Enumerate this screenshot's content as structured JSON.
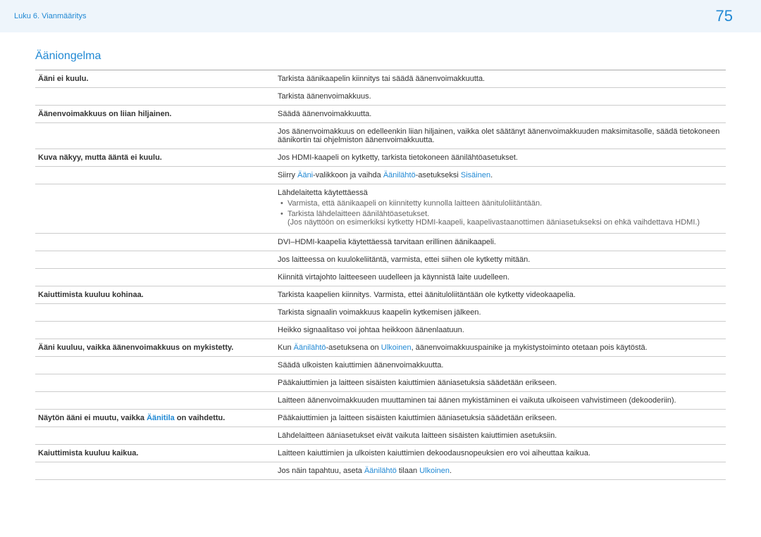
{
  "header": {
    "breadcrumb": "Luku 6. Vianmääritys",
    "page_number": "75"
  },
  "section_title": "Ääniongelma",
  "ui_terms": {
    "aani": "Ääni",
    "aanilahto": "Äänilähtö",
    "sisainen": "Sisäinen",
    "ulkoinen": "Ulkoinen",
    "aanitila": "Äänitila"
  },
  "rows": [
    {
      "left": "Ääni ei kuulu.",
      "right": "Tarkista äänikaapelin kiinnitys tai säädä äänenvoimakkuutta."
    },
    {
      "left": "",
      "right": "Tarkista äänenvoimakkuus."
    },
    {
      "left": "Äänenvoimakkuus on liian hiljainen.",
      "right": "Säädä äänenvoimakkuutta."
    },
    {
      "left": "",
      "right": "Jos äänenvoimakkuus on edelleenkin liian hiljainen, vaikka olet säätänyt äänenvoimakkuuden maksimitasolle, säädä tietokoneen äänikortin tai ohjelmiston äänenvoimakkuutta."
    },
    {
      "left": "Kuva näkyy, mutta ääntä ei kuulu.",
      "right": "Jos HDMI-kaapeli on kytketty, tarkista tietokoneen äänilähtöasetukset."
    },
    {
      "left": "",
      "right_pre": "Siirry ",
      "right_mid1": "-valikkoon ja vaihda ",
      "right_mid2": "-asetukseksi ",
      "right_post": "."
    },
    {
      "left": "",
      "subhead": "Lähdelaitetta käytettäessä",
      "bullet1": "Varmista, että äänikaapeli on kiinnitetty kunnolla laitteen äänituloliitäntään.",
      "bullet2": "Tarkista lähdelaitteen äänilähtöasetukset.",
      "note": "(Jos näyttöön on esimerkiksi kytketty HDMI-kaapeli, kaapelivastaanottimen ääniasetukseksi on ehkä vaihdettava HDMI.)"
    },
    {
      "left": "",
      "right": "DVI–HDMI-kaapelia käytettäessä tarvitaan erillinen äänikaapeli."
    },
    {
      "left": "",
      "right": "Jos laitteessa on kuulokeliitäntä, varmista, ettei siihen ole kytketty mitään."
    },
    {
      "left": "",
      "right": "Kiinnitä virtajohto laitteeseen uudelleen ja käynnistä laite uudelleen."
    },
    {
      "left": "Kaiuttimista kuuluu kohinaa.",
      "right": "Tarkista kaapelien kiinnitys. Varmista, ettei äänituloliitäntään ole kytketty videokaapelia."
    },
    {
      "left": "",
      "right": "Tarkista signaalin voimakkuus kaapelin kytkemisen jälkeen."
    },
    {
      "left": "",
      "right": "Heikko signaalitaso voi johtaa heikkoon äänenlaatuun."
    },
    {
      "left": "Ääni kuuluu, vaikka äänenvoimakkuus on mykistetty.",
      "right_pre": "Kun ",
      "right_mid1": "-asetuksena on ",
      "right_post": ", äänenvoimakkuuspainike ja mykistystoiminto otetaan pois käytöstä."
    },
    {
      "left": "",
      "right": "Säädä ulkoisten kaiuttimien äänenvoimakkuutta."
    },
    {
      "left": "",
      "right": "Pääkaiuttimien ja laitteen sisäisten kaiuttimien ääniasetuksia säädetään erikseen."
    },
    {
      "left": "",
      "right": "Laitteen äänenvoimakkuuden muuttaminen tai äänen mykistäminen ei vaikuta ulkoiseen vahvistimeen (dekooderiin)."
    },
    {
      "left_pre": "Näytön ääni ei muutu, vaikka ",
      "left_post": " on vaihdettu.",
      "right": "Pääkaiuttimien ja laitteen sisäisten kaiuttimien ääniasetuksia säädetään erikseen."
    },
    {
      "left": "",
      "right": "Lähdelaitteen ääniasetukset eivät vaikuta laitteen sisäisten kaiuttimien asetuksiin."
    },
    {
      "left": "Kaiuttimista kuuluu kaikua.",
      "right": "Laitteen kaiuttimien ja ulkoisten kaiuttimien dekoodausnopeuksien ero voi aiheuttaa kaikua."
    },
    {
      "left": "",
      "right_pre": "Jos näin tapahtuu, aseta ",
      "right_mid1": " tilaan ",
      "right_post": "."
    }
  ]
}
